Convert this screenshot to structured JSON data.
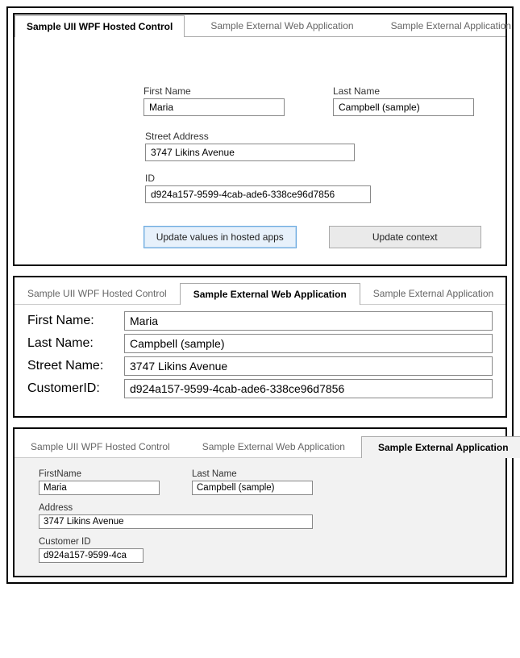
{
  "tabs": {
    "t1": "Sample UII WPF Hosted Control",
    "t2": "Sample External Web Application",
    "t3": "Sample External Application"
  },
  "panel1": {
    "first_name_label": "First Name",
    "first_name": "Maria",
    "last_name_label": "Last Name",
    "last_name": "Campbell (sample)",
    "street_label": "Street Address",
    "street": "3747 Likins Avenue",
    "id_label": "ID",
    "id": "d924a157-9599-4cab-ade6-338ce96d7856",
    "btn_update_hosted": "Update values in hosted apps",
    "btn_update_context": "Update context"
  },
  "panel2": {
    "first_name_label": "First Name:",
    "first_name": "Maria",
    "last_name_label": "Last Name:",
    "last_name": "Campbell (sample)",
    "street_label": "Street Name:",
    "street": "3747 Likins Avenue",
    "customer_id_label": "CustomerID:",
    "customer_id": "d924a157-9599-4cab-ade6-338ce96d7856"
  },
  "panel3": {
    "first_name_label": "FirstName",
    "first_name": "Maria",
    "last_name_label": "Last Name",
    "last_name": "Campbell (sample)",
    "address_label": "Address",
    "address": "3747 Likins Avenue",
    "customer_id_label": "Customer ID",
    "customer_id_display": "d924a157-9599-4ca"
  }
}
